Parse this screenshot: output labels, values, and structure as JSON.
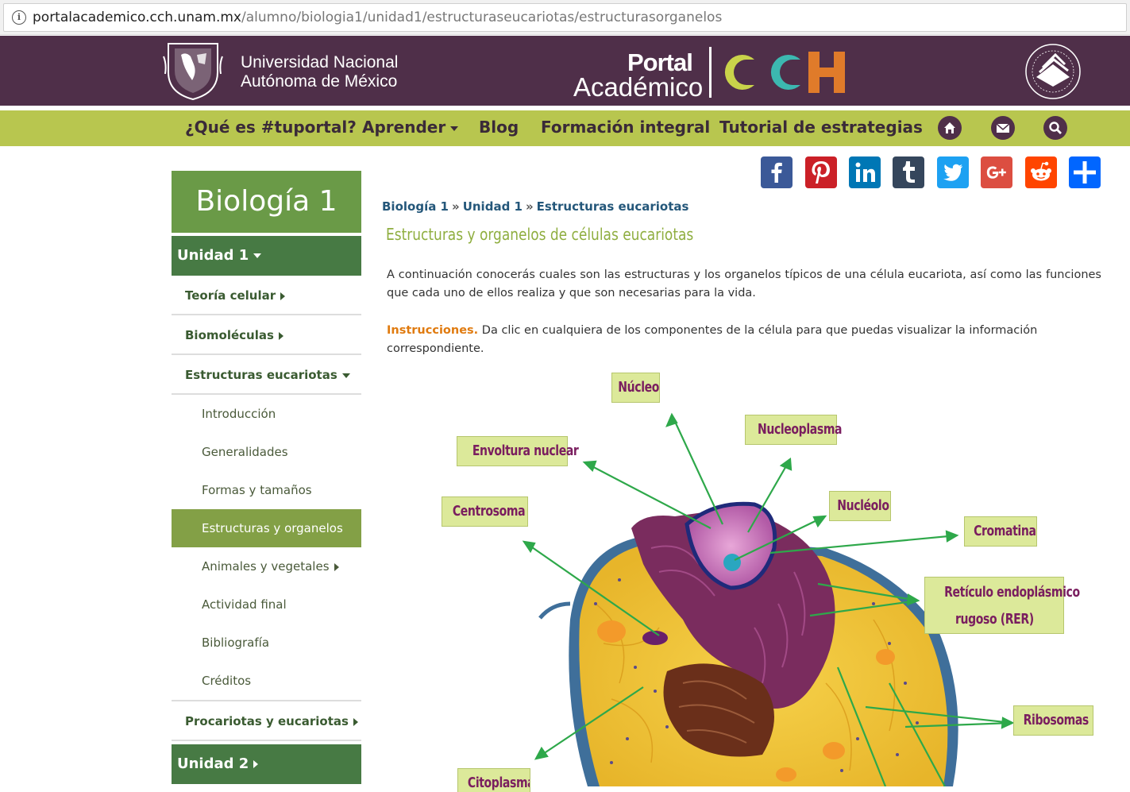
{
  "browser": {
    "url_host": "portalacademico.cch.unam.mx",
    "url_path": "/alumno/biologia1/unidad1/estructuraseucariotas/estructurasorganelos",
    "info_icon": "i"
  },
  "header": {
    "university_line1": "Universidad Nacional",
    "university_line2": "Autónoma de México",
    "portal_word": "Portal",
    "academico_word": "Académico",
    "cch": "CCH",
    "colors": {
      "header_bg": "#4f2f49",
      "nav_bg": "#b8c64f"
    }
  },
  "nav": {
    "items": [
      {
        "label": "¿Qué es #tuportal?"
      },
      {
        "label": "Aprender"
      },
      {
        "label": "Blog"
      },
      {
        "label": "Formación integral"
      },
      {
        "label": "Tutorial de estrategias"
      }
    ],
    "icons": [
      "home-icon",
      "mail-icon",
      "search-icon"
    ]
  },
  "social": [
    "facebook",
    "pinterest",
    "linkedin",
    "tumblr",
    "twitter",
    "google-plus",
    "reddit",
    "share"
  ],
  "sidebar": {
    "title": "Biología 1",
    "unit1": "Unidad 1",
    "items": [
      {
        "label": "Teoría celular"
      },
      {
        "label": "Biomoléculas"
      },
      {
        "label": "Estructuras eucariotas"
      }
    ],
    "subitems": [
      {
        "label": "Introducción"
      },
      {
        "label": "Generalidades"
      },
      {
        "label": "Formas y tamaños"
      },
      {
        "label": "Estructuras y organelos"
      },
      {
        "label": "Animales y vegetales"
      },
      {
        "label": "Actividad final"
      },
      {
        "label": "Bibliografía"
      },
      {
        "label": "Créditos"
      }
    ],
    "item_after": "Procariotas y eucariotas",
    "unit2": "Unidad 2"
  },
  "breadcrumb": {
    "items": [
      "Biología 1",
      "Unidad 1",
      "Estructuras eucariotas"
    ],
    "separator": "»"
  },
  "main": {
    "title": "Estructuras y organelos de células eucariotas",
    "intro": "A continuación conocerás cuales son las estructuras y los organelos típicos de una célula eucariota, así como las funciones que cada uno de ellos realiza y que son necesarias para la vida.",
    "instructions_label": "Instrucciones.",
    "instructions_text": " Da clic en cualquiera de los componentes de la célula para que puedas visualizar la información correspondiente."
  },
  "cell_labels": {
    "nucleo": "Núcleo",
    "nucleoplasma": "Nucleoplasma",
    "envoltura": "Envoltura nuclear",
    "centrosoma": "Centrosoma",
    "nucleolo": "Nucléolo",
    "cromatina": "Cromatina",
    "rer_line1": "Retículo endoplásmico",
    "rer_line2": "rugoso (RER)",
    "ribosomas": "Ribosomas",
    "citoplasma": "Citoplasma"
  }
}
